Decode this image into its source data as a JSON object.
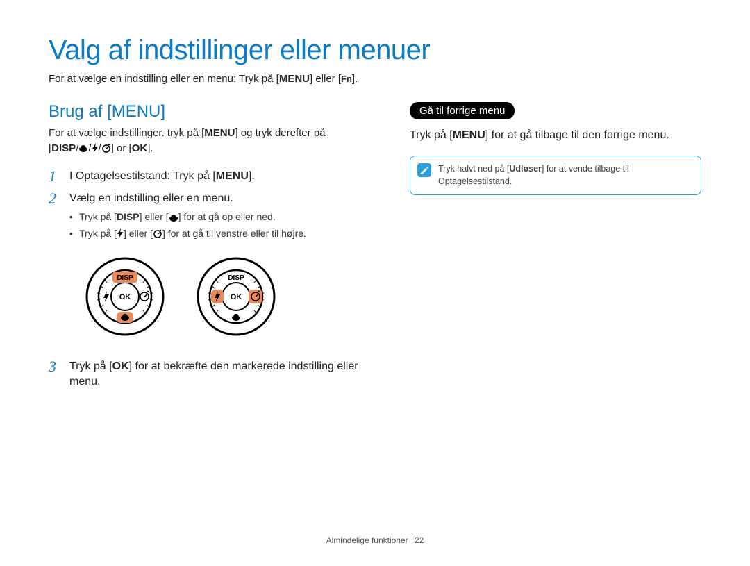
{
  "title": "Valg af indstillinger eller menuer",
  "intro_pre": "For at vælge en indstilling eller en menu: Tryk på [",
  "intro_key1": "MENU",
  "intro_mid": "] eller [",
  "intro_key2": "Fn",
  "intro_post": "].",
  "left": {
    "heading": "Brug af [MENU]",
    "l1_pre": "For at vælge indstillinger. tryk på [",
    "l1_key": "MENU",
    "l1_post": "] og tryk derefter på",
    "l2_pre": "[",
    "l2_disp": "DISP",
    "l2_or": "] or [",
    "l2_ok": "OK",
    "l2_end": "].",
    "steps": [
      {
        "num": "1",
        "text_pre": "I Optagelsestilstand: Tryk på [",
        "text_key": "MENU",
        "text_post": "]."
      },
      {
        "num": "2",
        "text": "Vælg en indstilling eller en menu.",
        "b1_pre": "Tryk på [",
        "b1_k1": "DISP",
        "b1_mid": "] eller [",
        "b1_post": "] for at gå op eller ned.",
        "b2_pre": "Tryk på [",
        "b2_mid": "] eller [",
        "b2_post": "] for at gå til venstre eller til højre."
      },
      {
        "num": "3",
        "text_pre": "Tryk på [",
        "text_key": "OK",
        "text_post": "] for at bekræfte den markerede indstilling eller menu."
      }
    ],
    "dial": {
      "disp": "DISP",
      "ok": "OK"
    }
  },
  "right": {
    "pill": "Gå til forrige menu",
    "text_pre": "Tryk på [",
    "text_key": "MENU",
    "text_post": "] for at gå tilbage til den forrige menu.",
    "note_pre": "Tryk halvt ned på [",
    "note_key": "Udløser",
    "note_post": "] for at vende tilbage til Optagelsestilstand."
  },
  "footer": {
    "section": "Almindelige funktioner",
    "page": "22"
  }
}
